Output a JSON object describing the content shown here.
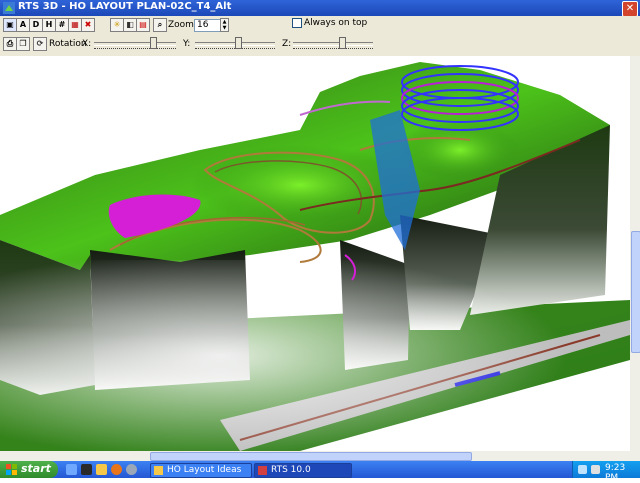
{
  "window": {
    "title": "RTS 3D - HO LAYOUT PLAN-02C_T4_Alt"
  },
  "toolbar": {
    "view_buttons": [
      "A",
      "D",
      "H"
    ],
    "zoom_label": "Zoom:",
    "zoom_value": "16",
    "always_on_top_label": "Always on top",
    "always_on_top_checked": false,
    "rotation_label": "Rotation",
    "axes": {
      "x": "X:",
      "y": "Y:",
      "z": "Z:"
    }
  },
  "taskbar": {
    "start_label": "start",
    "tasks": [
      {
        "label": "HO Layout Ideas",
        "icon": "folder-icon",
        "active": false
      },
      {
        "label": "RTS 10.0",
        "icon": "rts-app-icon",
        "active": true
      }
    ],
    "clock": "9:23 PM"
  },
  "colors": {
    "titlebar": "#1c48b8",
    "taskbar": "#2457d4",
    "start": "#2f8b2b",
    "terrain": "#3f9a1a",
    "track": "#b07a3a",
    "helix": "#3333ff",
    "highlight": "#d41fd6"
  }
}
